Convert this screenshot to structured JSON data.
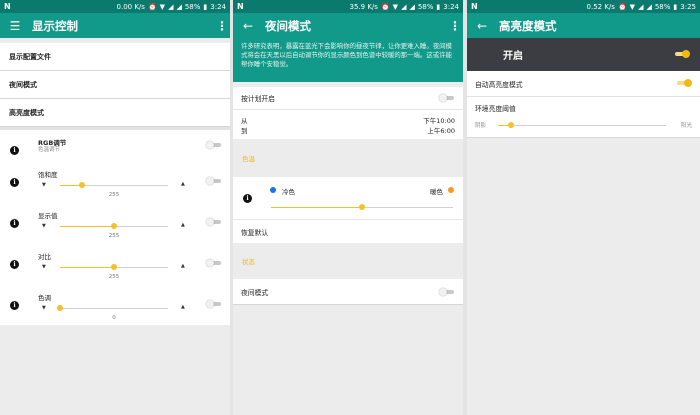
{
  "status_bars": [
    {
      "speed": "0.00 K/s",
      "battery": "58%",
      "time": "3:24"
    },
    {
      "speed": "35.9 K/s",
      "battery": "58%",
      "time": "3:24"
    },
    {
      "speed": "0.52 K/s",
      "battery": "58%",
      "time": "3:25"
    }
  ],
  "panel1": {
    "title": "显示控制",
    "menu_items": [
      "显示配置文件",
      "夜间模式",
      "高亮度模式"
    ],
    "rgb": {
      "label": "RGB调节",
      "sub": "色温调节"
    },
    "sliders": [
      {
        "label": "饱和度",
        "value": "255",
        "fraction": 0.2
      },
      {
        "label": "显示值",
        "value": "255",
        "fraction": 0.5
      },
      {
        "label": "对比",
        "value": "255",
        "fraction": 0.5
      },
      {
        "label": "色调",
        "value": "0",
        "fraction": 0.0
      }
    ]
  },
  "panel2": {
    "title": "夜间模式",
    "banner": "许多研究表明，暴露在蓝光下会影响你的昼夜节律，让你更难入睡。夜间模式将会在天黑以后自动调节你的显示颜色到色谱中较暖的那一端。这或许能帮你睡个安稳觉。",
    "schedule_label": "按计划开启",
    "from_label": "从",
    "from_value": "下午10:00",
    "to_label": "到",
    "to_value": "上午6:00",
    "color_section": "色温",
    "cool_label": "冷色",
    "warm_label": "暖色",
    "temp_fraction": 0.5,
    "restore_label": "恢复默认",
    "state_section": "状态",
    "night_mode_label": "夜间模式"
  },
  "panel3": {
    "title": "高亮度模式",
    "master_label": "开启",
    "auto_label": "自动高亮度模式",
    "threshold_label": "环境亮度阈值",
    "min_label": "阴影",
    "max_label": "阳光",
    "threshold_fraction": 0.08
  },
  "colors": {
    "accent": "#f6c02a",
    "toolbar": "#11998a",
    "statusbar": "#0b7a6e",
    "cool": "#1a73e8",
    "warm": "#f59a1b"
  }
}
